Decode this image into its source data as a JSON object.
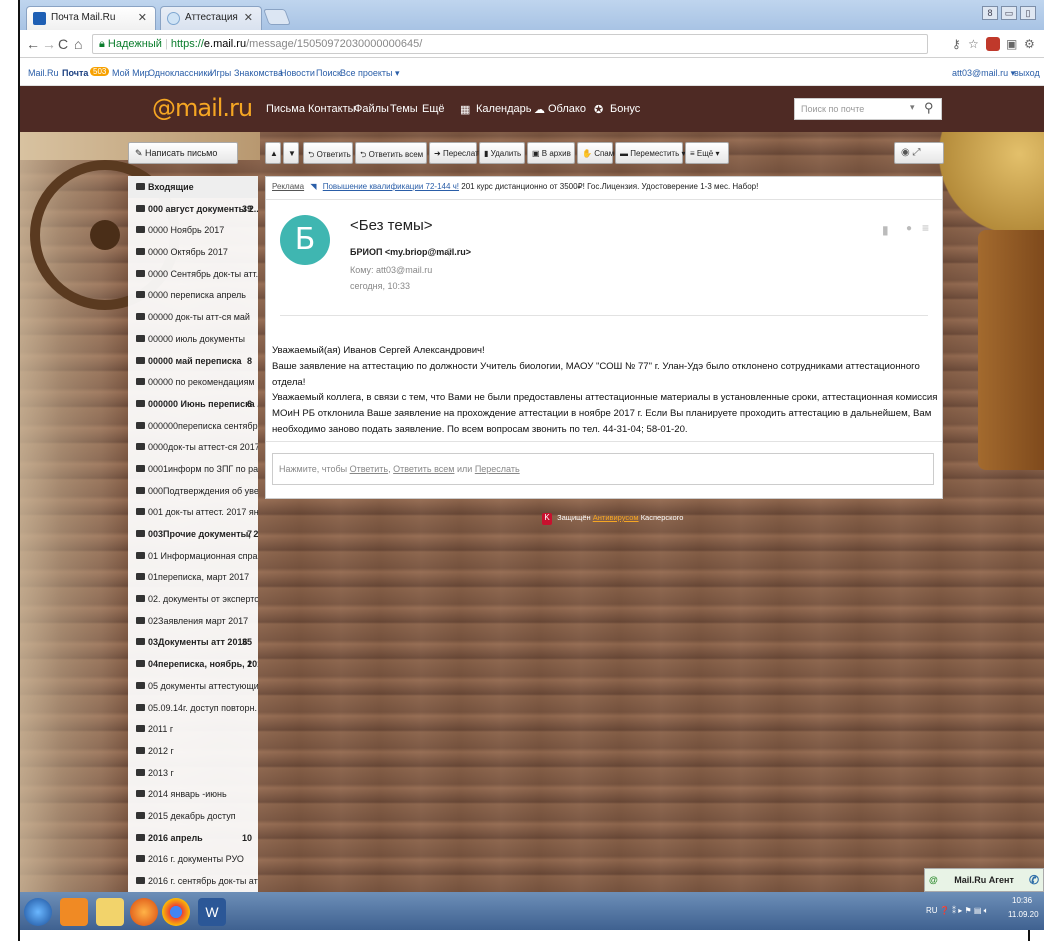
{
  "browser": {
    "tabs": [
      {
        "label": "Почта Mail.Ru"
      },
      {
        "label": "Аттестация"
      }
    ],
    "url": {
      "secure_label": "Надежный",
      "protocol": "https://",
      "domain": "e.mail.ru",
      "path": "/message/15050972030000000645/"
    }
  },
  "bookmarks": {
    "items": [
      "Mail.Ru",
      "Почта",
      "Мой Мир",
      "Одноклассники",
      "Игры",
      "Знакомства",
      "Новости",
      "Поиск",
      "Все проекты ▾"
    ],
    "badge": "503",
    "account": "att03@mail.ru ▾",
    "logout": "выход"
  },
  "mailheader": {
    "logo": "@mail.ru",
    "nav": [
      "Письма",
      "Контакты",
      "Файлы",
      "Темы",
      "Ещё"
    ],
    "extra": [
      "Календарь",
      "Облако",
      "Бонус"
    ],
    "search_placeholder": "Поиск по почте"
  },
  "toolbar": {
    "compose": "Написать письмо",
    "buttons": [
      "▲",
      "▼",
      "Ответить",
      "Ответить всем",
      "Переслать",
      "Удалить",
      "В архив",
      "Спам",
      "Переместить ▾",
      "≡ Ещё ▾"
    ]
  },
  "folders": [
    {
      "name": "Входящие",
      "bold": true,
      "count": ""
    },
    {
      "name": "000 август документы 2...",
      "bold": true,
      "count": "39"
    },
    {
      "name": "0000 Ноябрь 2017",
      "bold": false,
      "count": ""
    },
    {
      "name": "0000 Октябрь 2017",
      "bold": false,
      "count": ""
    },
    {
      "name": "0000 Сентябрь док-ты атт. 2017",
      "bold": false,
      "count": ""
    },
    {
      "name": "0000 переписка апрель",
      "bold": false,
      "count": ""
    },
    {
      "name": "00000 док-ты атт-ся май",
      "bold": false,
      "count": ""
    },
    {
      "name": "00000 июль документы",
      "bold": false,
      "count": ""
    },
    {
      "name": "00000 май переписка",
      "bold": true,
      "count": "8"
    },
    {
      "name": "00000 по рекомендациям",
      "bold": false,
      "count": ""
    },
    {
      "name": "000000 Июнь переписка ...",
      "bold": true,
      "count": "6"
    },
    {
      "name": "000000переписка сентябрь 2017",
      "bold": false,
      "count": ""
    },
    {
      "name": "0000док-ты аттест-ся 2017 апр...",
      "bold": false,
      "count": ""
    },
    {
      "name": "0001информ по ЗПГ по районам",
      "bold": false,
      "count": ""
    },
    {
      "name": "000Подтверждения об увед. 2...",
      "bold": false,
      "count": ""
    },
    {
      "name": "001 док-ты аттест. 2017 январь",
      "bold": false,
      "count": ""
    },
    {
      "name": "003Прочие документы, 2...",
      "bold": true,
      "count": "7"
    },
    {
      "name": "01 Информационная справка ...",
      "bold": false,
      "count": ""
    },
    {
      "name": "01переписка, март 2017",
      "bold": false,
      "count": ""
    },
    {
      "name": "02. документы от экспертов, 2...",
      "bold": false,
      "count": ""
    },
    {
      "name": "02Заявления март 2017",
      "bold": false,
      "count": ""
    },
    {
      "name": "03Документы атт 2016",
      "bold": true,
      "count": "35"
    },
    {
      "name": "04переписка, ноябрь, 2016",
      "bold": true,
      "count": "1"
    },
    {
      "name": "05 документы аттестующихся ...",
      "bold": false,
      "count": ""
    },
    {
      "name": "05.09.14г. доступ повторн.",
      "bold": false,
      "count": ""
    },
    {
      "name": "2011 г",
      "bold": false,
      "count": ""
    },
    {
      "name": "2012 г",
      "bold": false,
      "count": ""
    },
    {
      "name": "2013 г",
      "bold": false,
      "count": ""
    },
    {
      "name": "2014 январь -июнь",
      "bold": false,
      "count": ""
    },
    {
      "name": "2015 декабрь доступ",
      "bold": false,
      "count": ""
    },
    {
      "name": "2016 апрель",
      "bold": true,
      "count": "10"
    },
    {
      "name": "2016 г. документы РУО",
      "bold": false,
      "count": ""
    },
    {
      "name": "2016 г. сентябрь док-ты атт.",
      "bold": false,
      "count": ""
    }
  ],
  "message": {
    "ad_label": "Реклама",
    "ad_link": "Повышение квалификации 72-144 ч!",
    "ad_text": "201 курс дистанционно от 3500₽! Гос.Лицензия. Удостоверение 1-3 мес. Набор!",
    "avatar_letter": "Б",
    "subject": "<Без темы>",
    "sender": "БРИОП <my.briop@mail.ru>",
    "to": "Кому: att03@mail.ru",
    "date": "сегодня, 10:33",
    "body": [
      "Уважаемый(ая) Иванов Сергей Александрович!",
      "Ваше заявление на аттестацию по должности Учитель биологии, МАОУ \"СОШ № 77\" г. Улан-Удэ было отклонено сотрудниками аттестационного отдела!",
      "Уважаемый коллега, в связи с тем, что Вами не были предоставлены аттестационные материалы в установленные сроки, аттестационная комиссия МОиН РБ отклонила Ваше заявление на прохождение аттестации в ноябре 2017 г. Если Вы планируете проходить аттестацию в дальнейшем, Вам необходимо заново подать заявление. По всем вопросам звонить по тел. 44-31-04; 58-01-20."
    ],
    "reply_prefix": "Нажмите, чтобы",
    "reply_link1": "Ответить",
    "reply_link2": "Ответить всем",
    "reply_or": "или",
    "reply_link3": "Переслать"
  },
  "kaspersky": {
    "prefix": "Защищён",
    "link": "Антивирусом",
    "suffix": "Касперского"
  },
  "agent": {
    "label": "Mail.Ru Агент"
  },
  "taskbar": {
    "lang": "RU",
    "time": "10:36",
    "date": "11.09.20"
  }
}
